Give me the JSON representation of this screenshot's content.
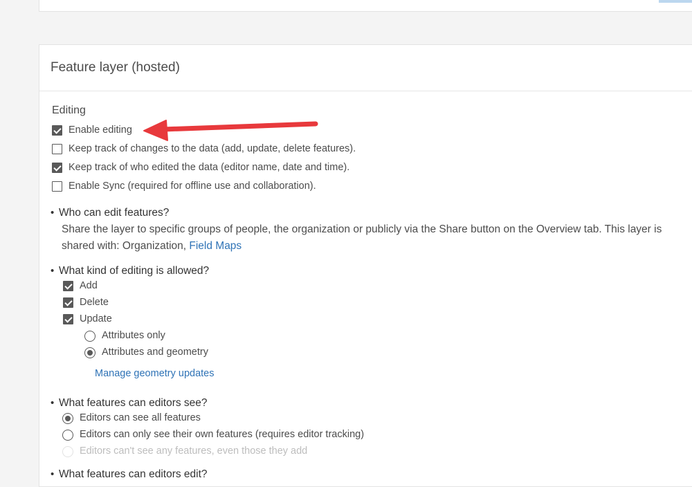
{
  "card": {
    "title": "Feature layer (hosted)"
  },
  "editing": {
    "label": "Editing",
    "options": [
      {
        "label": "Enable editing",
        "checked": true
      },
      {
        "label": "Keep track of changes to the data (add, update, delete features).",
        "checked": false
      },
      {
        "label": "Keep track of who edited the data (editor name, date and time).",
        "checked": true
      },
      {
        "label": "Enable Sync (required for offline use and collaboration).",
        "checked": false
      }
    ]
  },
  "who_can_edit": {
    "question": "Who can edit features?",
    "description_line1": "Share the layer to specific groups of people, the organization or publicly via the Share button on the Overview tab. This layer is",
    "description_line2": "shared with: Organization, ",
    "group_link": "Field Maps"
  },
  "editing_kind": {
    "question": "What kind of editing is allowed?",
    "options": [
      {
        "label": "Add",
        "checked": true
      },
      {
        "label": "Delete",
        "checked": true
      },
      {
        "label": "Update",
        "checked": true
      }
    ],
    "update_options": [
      {
        "label": "Attributes only",
        "selected": false
      },
      {
        "label": "Attributes and geometry",
        "selected": true
      }
    ],
    "manage_link": "Manage geometry updates"
  },
  "features_see": {
    "question": "What features can editors see?",
    "options": [
      {
        "label": "Editors can see all features",
        "selected": true,
        "disabled": false
      },
      {
        "label": "Editors can only see their own features (requires editor tracking)",
        "selected": false,
        "disabled": false
      },
      {
        "label": "Editors can't see any features, even those they add",
        "selected": false,
        "disabled": true
      }
    ]
  },
  "features_edit": {
    "question": "What features can editors edit?"
  },
  "annotation": {
    "arrow_color": "#e8393c"
  }
}
